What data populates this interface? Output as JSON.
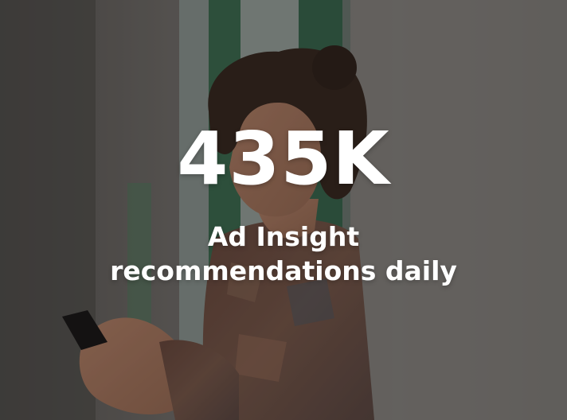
{
  "stat": {
    "number": "435K",
    "caption_line1": "Ad Insight",
    "caption_line2": "recommendations daily"
  },
  "colors": {
    "text": "#ffffff",
    "wall": "#8a8683",
    "window_frame": "#3f6e52"
  }
}
